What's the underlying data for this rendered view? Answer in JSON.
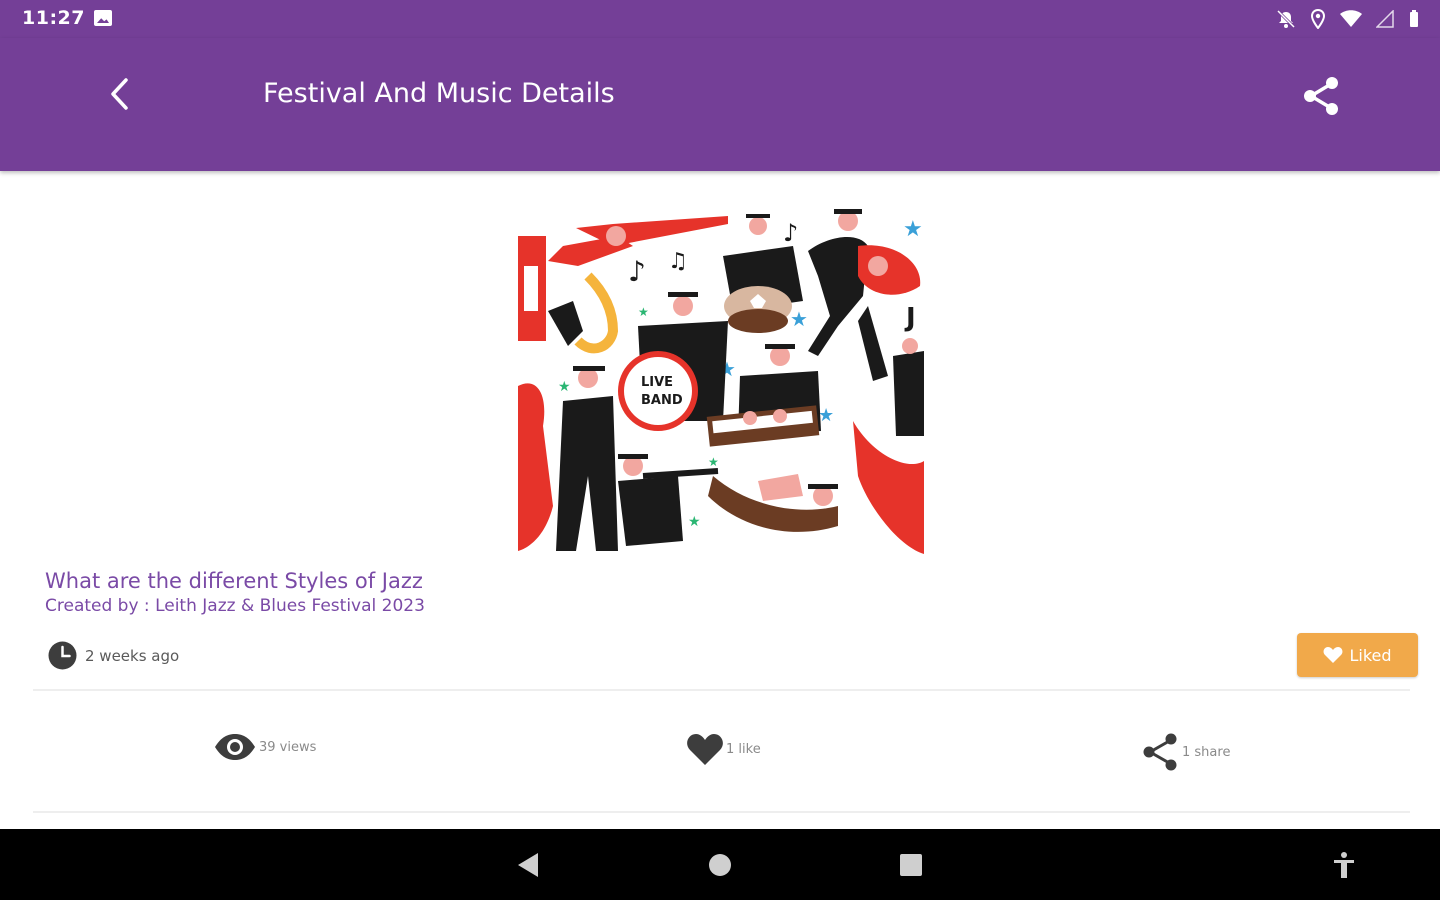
{
  "status_bar": {
    "time": "11:27",
    "icons": [
      "image-notification-icon",
      "mute-icon",
      "location-icon",
      "wifi-icon",
      "signal-icon",
      "battery-icon"
    ]
  },
  "app_bar": {
    "title": "Festival And Music Details",
    "back_icon": "chevron-left-icon",
    "share_icon": "share-icon"
  },
  "hero": {
    "art_text_1": "LIVE",
    "art_text_2": "BAND",
    "art_text_3": "J"
  },
  "article": {
    "title": "What are the different Styles of Jazz",
    "author": "Created by : Leith Jazz & Blues Festival 2023",
    "time_ago": "2 weeks ago"
  },
  "actions": {
    "liked_label": "Liked"
  },
  "stats": {
    "views": "39 views",
    "likes": "1 like",
    "shares": "1 share"
  },
  "colors": {
    "primary": "#743f97",
    "accent": "#f1a94a",
    "title_text": "#7a4aa6"
  },
  "nav": {
    "back_icon": "triangle-back-icon",
    "home_icon": "circle-home-icon",
    "recents_icon": "square-recents-icon",
    "accessibility_icon": "accessibility-icon"
  }
}
